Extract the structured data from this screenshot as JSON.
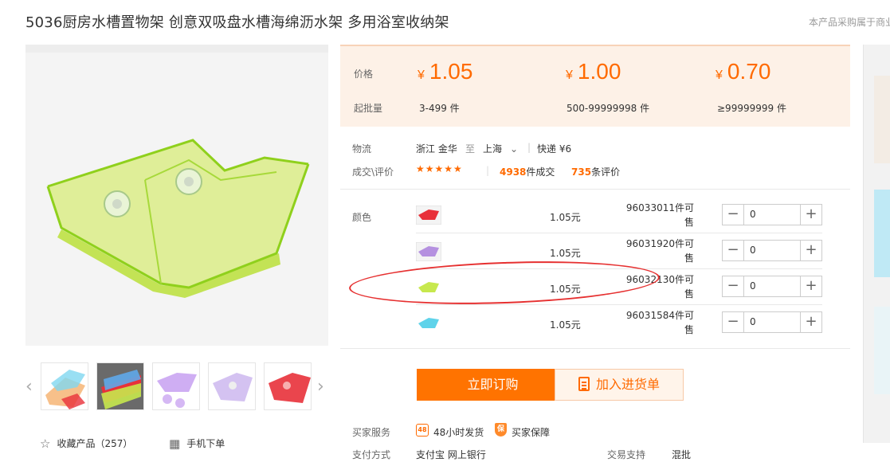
{
  "product": {
    "title": "5036厨房水槽置物架 创意双吸盘水槽海绵沥水架 多用浴室收纳架",
    "top_note": "本产品采购属于商业"
  },
  "gallery": {
    "thumb_count": 5,
    "prev_icon": "chevron-left-icon",
    "next_icon": "chevron-right-icon",
    "favorite_label": "收藏产品（257）",
    "mobile_order_label": "手机下单"
  },
  "price": {
    "price_label": "价格",
    "moq_label": "起批量",
    "currency": "¥",
    "tiers": [
      {
        "price": "1.05",
        "quantity": "3-499 件"
      },
      {
        "price": "1.00",
        "quantity": "500-99999998 件"
      },
      {
        "price": "0.70",
        "quantity": "≥99999999 件"
      }
    ]
  },
  "logistics": {
    "label": "物流",
    "from": "浙江 金华",
    "to_word": "至",
    "to": "上海",
    "shipping": "快递 ¥6"
  },
  "reviews": {
    "label": "成交\\评价",
    "rating": 4.5,
    "deals_count": "4938",
    "deals_suffix": "件成交",
    "review_count": "735",
    "review_suffix": "条评价"
  },
  "sku": {
    "label": "颜色",
    "items": [
      {
        "color": "#e8313a",
        "price": "1.05元",
        "stock": "96033011件可售",
        "qty": "0"
      },
      {
        "color": "#b591e0",
        "price": "1.05元",
        "stock": "96031920件可售",
        "qty": "0"
      },
      {
        "color": "#c7e84e",
        "price": "1.05元",
        "stock": "96032130件可售",
        "qty": "0"
      },
      {
        "color": "#5fd3ea",
        "price": "1.05元",
        "stock": "96031584件可售",
        "qty": "0"
      }
    ]
  },
  "actions": {
    "buy_now": "立即订购",
    "add_to_cart": "加入进货单"
  },
  "services": {
    "buyer_label": "买家服务",
    "ship_48h": "48小时发货",
    "buyer_protect": "买家保障",
    "pay_label": "支付方式",
    "pay_methods": "支付宝  网上银行",
    "trade_label": "交易支持",
    "trade_value": "混批"
  },
  "colors": {
    "accent": "#ff6a00",
    "price_bg": "#fdf1e7",
    "annotation": "#e63030"
  }
}
